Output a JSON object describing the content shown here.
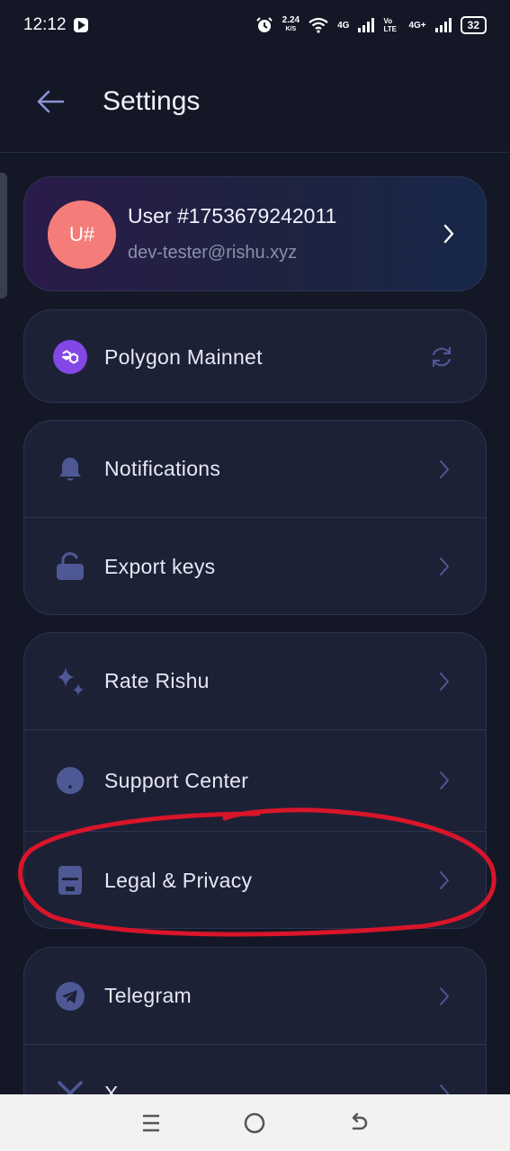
{
  "status_bar": {
    "time": "12:12",
    "speed_value": "2.24",
    "speed_unit": "K/S",
    "net1": "4G",
    "volte": "Vo LTE",
    "net2": "4G+",
    "battery": "32"
  },
  "header": {
    "title": "Settings"
  },
  "profile": {
    "avatar_initials": "U#",
    "name": "User #1753679242011",
    "email": "dev-tester@rishu.xyz"
  },
  "network": {
    "label": "Polygon Mainnet",
    "icon": "polygon-logo-icon",
    "action_icon": "refresh-icon"
  },
  "groups": {
    "account": [
      {
        "label": "Notifications",
        "icon": "bell-icon"
      },
      {
        "label": "Export keys",
        "icon": "unlock-icon"
      }
    ],
    "about": [
      {
        "label": "Rate Rishu",
        "icon": "sparkle-icon"
      },
      {
        "label": "Support Center",
        "icon": "support-icon"
      },
      {
        "label": "Legal & Privacy",
        "icon": "document-icon"
      }
    ],
    "social": [
      {
        "label": "Telegram",
        "icon": "telegram-icon"
      },
      {
        "label": "X",
        "icon": "x-icon"
      }
    ]
  },
  "colors": {
    "background": "#141826",
    "card": "#1d2136",
    "icon_accent": "#4d5894",
    "annotation": "#d8152a",
    "avatar": "#f47d79",
    "polygon": "#8247e5"
  }
}
